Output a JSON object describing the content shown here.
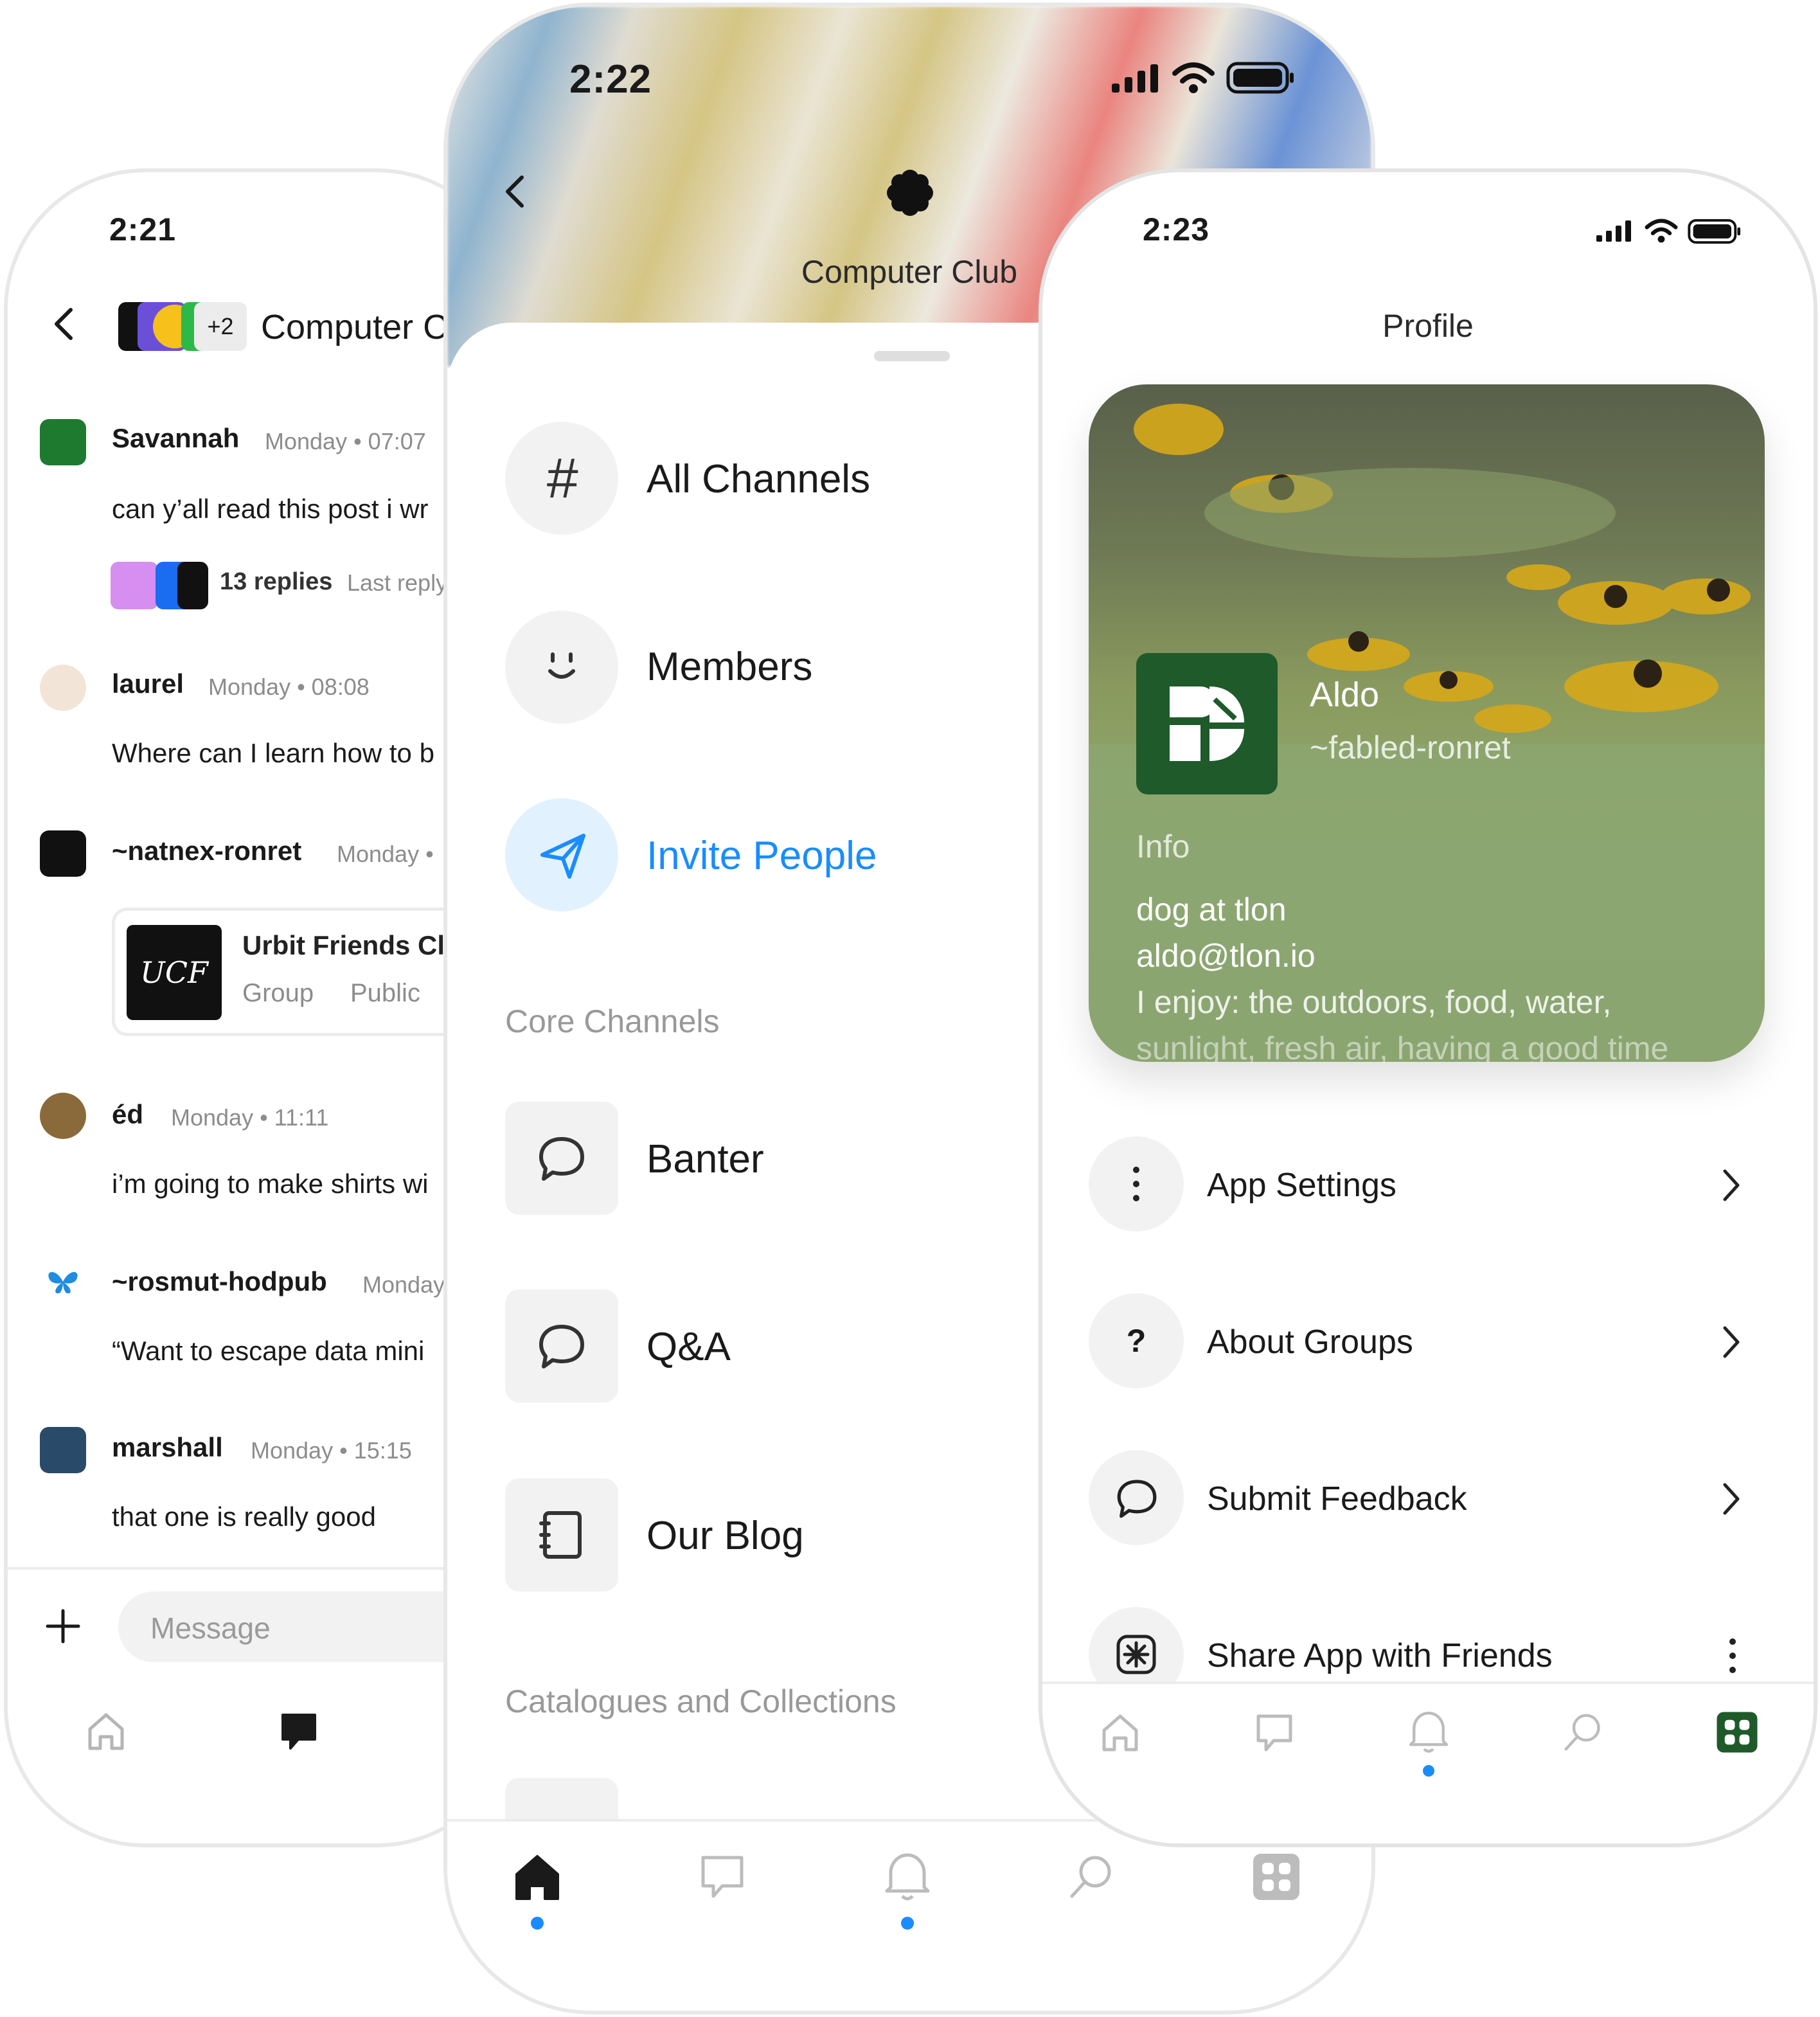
{
  "left_screen": {
    "time": "2:21",
    "header_title": "Computer C",
    "avatar_more": "+2",
    "messages": [
      {
        "author": "Savannah",
        "meta": "Monday • 07:07",
        "text": "can y’all read this post i wr",
        "replies": "13 replies",
        "last_reply": "Last reply"
      },
      {
        "author": "laurel",
        "meta": "Monday • 08:08",
        "text": "Where can I learn how to b"
      },
      {
        "author": "~natnex-ronret",
        "meta": "Monday •",
        "card_title": "Urbit Friends Cl",
        "card_type": "Group",
        "card_visibility": "Public",
        "card_logo": "UCF"
      },
      {
        "author": "éd",
        "meta": "Monday • 11:11",
        "text": "i’m going to make shirts wi"
      },
      {
        "author": "~rosmut-hodpub",
        "meta": "Monday",
        "text": "“Want to escape data mini"
      },
      {
        "author": "marshall",
        "meta": "Monday • 15:15",
        "text": "that one is really good"
      }
    ],
    "message_placeholder": "Message"
  },
  "middle_screen": {
    "time": "2:22",
    "group_title": "Computer Club",
    "menu": [
      {
        "label": "All Channels",
        "icon": "hash-icon"
      },
      {
        "label": "Members",
        "icon": "smile-icon"
      },
      {
        "label": "Invite People",
        "icon": "send-icon"
      }
    ],
    "section_core": "Core Channels",
    "channels": [
      {
        "label": "Banter",
        "icon": "chat-bubble-icon"
      },
      {
        "label": "Q&A",
        "icon": "chat-bubble-icon"
      },
      {
        "label": "Our Blog",
        "icon": "notebook-icon"
      }
    ],
    "section_catalogues": "Catalogues and Collections",
    "accent": "#1a8cff"
  },
  "right_screen": {
    "time": "2:23",
    "title": "Profile",
    "profile": {
      "name": "Aldo",
      "handle": "~fabled-ronret",
      "info_label": "Info",
      "info_lines": [
        "dog at tlon",
        "aldo@tlon.io",
        "I enjoy: the outdoors, food, water,",
        "sunlight, fresh air, having a good time"
      ]
    },
    "settings": [
      {
        "label": "App Settings",
        "icon": "more-vertical-icon"
      },
      {
        "label": "About Groups",
        "icon": "question-icon"
      },
      {
        "label": "Submit Feedback",
        "icon": "chat-bubble-icon"
      },
      {
        "label": "Share App with Friends",
        "icon": "share-icon"
      }
    ],
    "brand_color": "#1e5a2a"
  }
}
